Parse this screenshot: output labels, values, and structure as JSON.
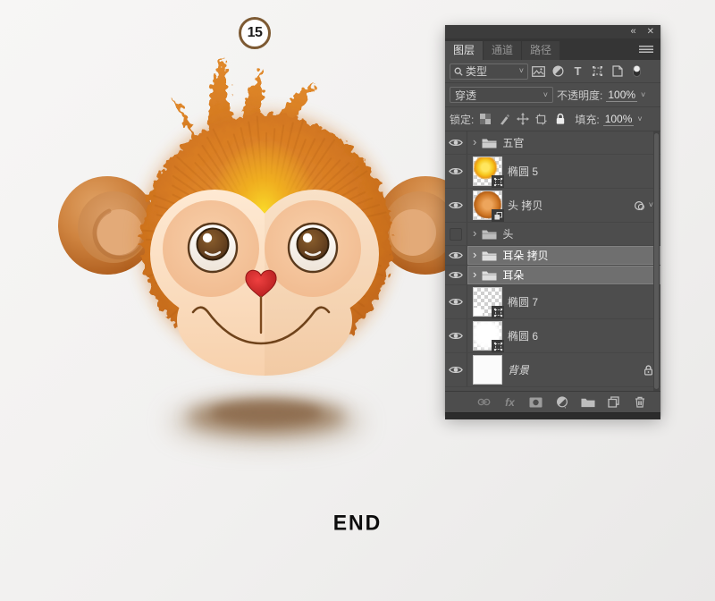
{
  "step_badge": {
    "value": "15"
  },
  "footer": {
    "end_label": "END"
  },
  "icons": {
    "collapse": "«",
    "close": "✕",
    "chevron_down": "˅",
    "disclosure": "›"
  },
  "panel": {
    "tabs": {
      "layers": "图层",
      "channels": "通道",
      "paths": "路径"
    },
    "filter_row": {
      "kind_value": "类型"
    },
    "blend_row": {
      "mode_value": "穿透",
      "opacity_label": "不透明度:",
      "opacity_value": "100%"
    },
    "lock_row": {
      "lock_label": "锁定:",
      "fill_label": "填充:",
      "fill_value": "100%"
    },
    "layers": [
      {
        "name": "五官",
        "kind": "group",
        "visible": true,
        "selected": false
      },
      {
        "name": "椭圆 5",
        "kind": "shape",
        "visible": true,
        "selected": false,
        "thumb": "yellow-burst"
      },
      {
        "name": "头 拷贝",
        "kind": "smart-object",
        "visible": true,
        "selected": false,
        "thumb": "orange-ball",
        "has_smart_filter": true
      },
      {
        "name": "头",
        "kind": "group",
        "visible": false,
        "selected": false
      },
      {
        "name": "耳朵 拷贝",
        "kind": "group",
        "visible": true,
        "selected": true
      },
      {
        "name": "耳朵",
        "kind": "group",
        "visible": true,
        "selected": true
      },
      {
        "name": "椭圆 7",
        "kind": "shape",
        "visible": true,
        "selected": false,
        "thumb": "checker-wedge"
      },
      {
        "name": "椭圆 6",
        "kind": "shape",
        "visible": true,
        "selected": false,
        "thumb": "white-blob"
      },
      {
        "name": "背景",
        "kind": "background",
        "visible": true,
        "selected": false,
        "locked": true
      }
    ],
    "toolbar": {
      "fx_label": "fx"
    }
  },
  "colors": {
    "panel_bg": "#4d4d4d",
    "panel_titlebar": "#3c3c3c",
    "selected_row": "#6f6f6f",
    "fur_main": "#d87c22",
    "fur_glow": "#f7ce25",
    "face": "#fbdcbd",
    "eye_patch": "#f5c6a0",
    "iris_brown": "#6b4521",
    "nose_red": "#cf2427",
    "badge_ring": "#7d5a33",
    "page_bg": "#f1f0ef"
  }
}
